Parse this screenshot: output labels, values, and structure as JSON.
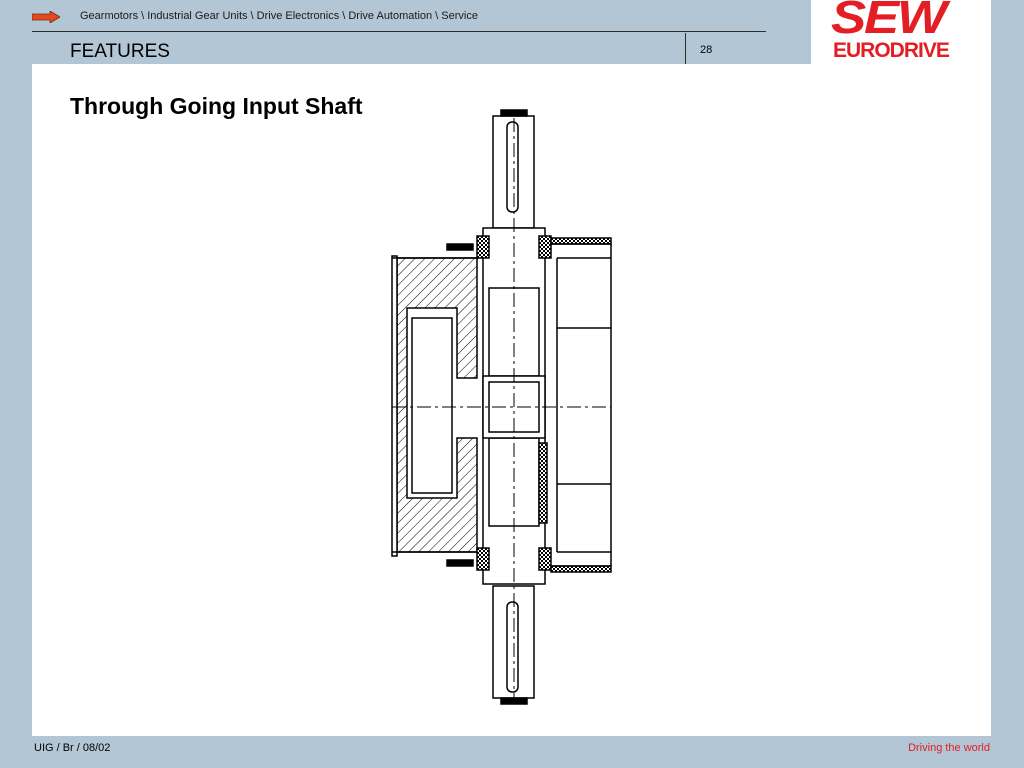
{
  "header": {
    "breadcrumb": "Gearmotors \\ Industrial Gear Units \\ Drive Electronics \\ Drive Automation \\ Service",
    "section_title": "FEATURES",
    "page_number": "28",
    "arrow_color": "#e04a1f"
  },
  "logo": {
    "line1": "SEW",
    "line2": "EURODRIVE",
    "color": "#e31e24"
  },
  "slide": {
    "title": "Through Going Input Shaft"
  },
  "footer": {
    "left": "UIG / Br / 08/02",
    "right": "Driving the world"
  }
}
